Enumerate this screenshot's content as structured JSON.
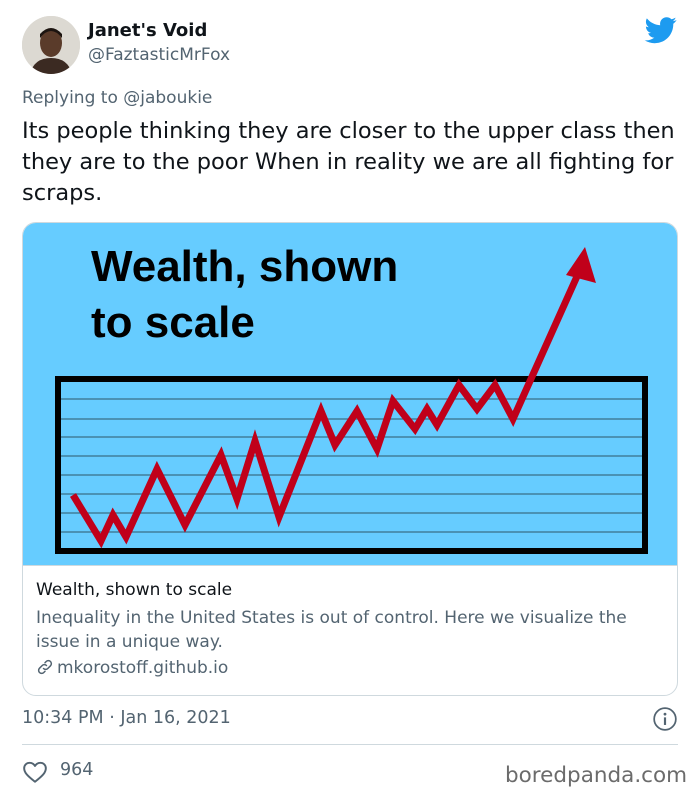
{
  "author": {
    "name": "Janet's Void",
    "handle": "@FaztasticMrFox"
  },
  "reply": {
    "prefix": "Replying to ",
    "mention": "@jaboukie"
  },
  "tweet": {
    "text": "Its people thinking they are closer to the upper class then they are to the poor When in reality we are all fighting for scraps."
  },
  "card": {
    "image_heading_line1": "Wealth, shown",
    "image_heading_line2": "to scale",
    "title": "Wealth, shown to scale",
    "description": "Inequality in the United States is out of control. Here we visualize the issue in a unique way.",
    "domain": "mkorostoff.github.io"
  },
  "meta": {
    "timestamp": "10:34 PM · Jan 16, 2021",
    "likes": "964"
  },
  "watermark": "boredpanda.com",
  "colors": {
    "twitter_blue": "#1d9bf0",
    "card_image_bg": "#66ccff",
    "arrow_red": "#c0001a",
    "secondary_text": "#536471"
  },
  "icons": [
    "twitter-bird-icon",
    "link-icon",
    "info-icon",
    "heart-icon"
  ]
}
